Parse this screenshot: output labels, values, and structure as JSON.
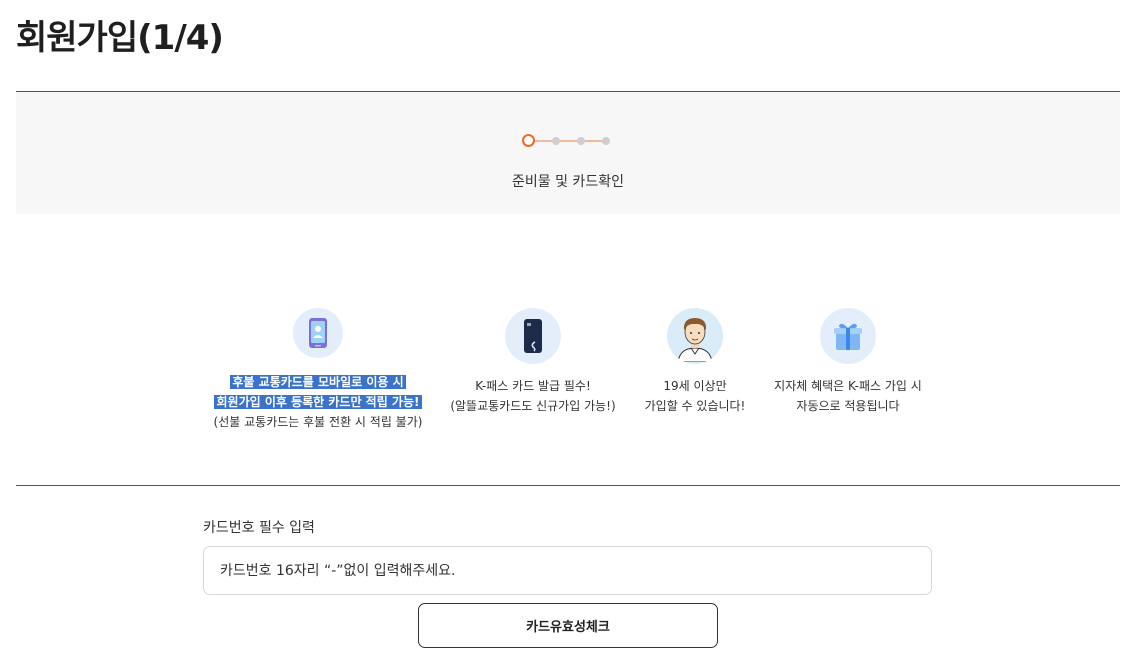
{
  "page": {
    "title": "회원가입(1/4)"
  },
  "stepper": {
    "current_step": 1,
    "total_steps": 4,
    "current_label": "준비물 및 카드확인"
  },
  "colors": {
    "accent": "#ef6a24",
    "highlight": "#3a73c9",
    "icon_bg": "#e4eefb"
  },
  "features": [
    {
      "icon": "phone-card-icon",
      "lines": [
        "후불 교통카드를 모바일로 이용 시",
        "회원가입 이후 등록한 카드만 적립 가능!",
        "(선불 교통카드는 후불 전환 시 적립 불가)"
      ]
    },
    {
      "icon": "kpass-card-icon",
      "lines": [
        "K-패스 카드 발급 필수!",
        "(알뜰교통카드도 신규가입 가능!)"
      ]
    },
    {
      "icon": "person-icon",
      "lines": [
        "19세 이상만",
        "가입할 수 있습니다!"
      ]
    },
    {
      "icon": "gift-icon",
      "lines": [
        "지자체 혜택은 K-패스 가입 시",
        "자동으로 적용됩니다"
      ]
    }
  ],
  "card_form": {
    "label": "카드번호 필수 입력",
    "placeholder": "카드번호 16자리 “-”없이 입력해주세요.",
    "value": "",
    "check_button": "카드유효성체크"
  }
}
